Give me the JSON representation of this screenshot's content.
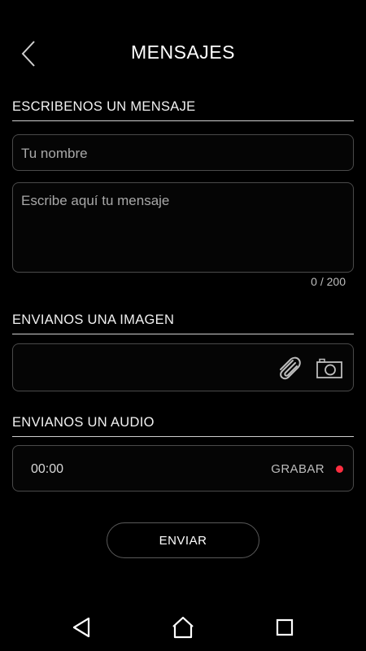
{
  "header": {
    "title": "MENSAJES",
    "back_icon": "chevron-left-icon"
  },
  "message_section": {
    "heading": "ESCRIBENOS UN MENSAJE",
    "name_placeholder": "Tu nombre",
    "message_placeholder": "Escribe aquí tu mensaje",
    "counter": "0 / 200"
  },
  "image_section": {
    "heading": "ENVIANOS UNA IMAGEN",
    "attach_icon": "paperclip-icon",
    "camera_icon": "camera-icon"
  },
  "audio_section": {
    "heading": "ENVIANOS UN AUDIO",
    "time": "00:00",
    "record_label": "GRABAR",
    "record_color": "#ff2e40"
  },
  "send_label": "ENVIAR",
  "navbar": {
    "back_icon": "nav-back-triangle-icon",
    "home_icon": "nav-home-icon",
    "recent_icon": "nav-recent-square-icon"
  }
}
